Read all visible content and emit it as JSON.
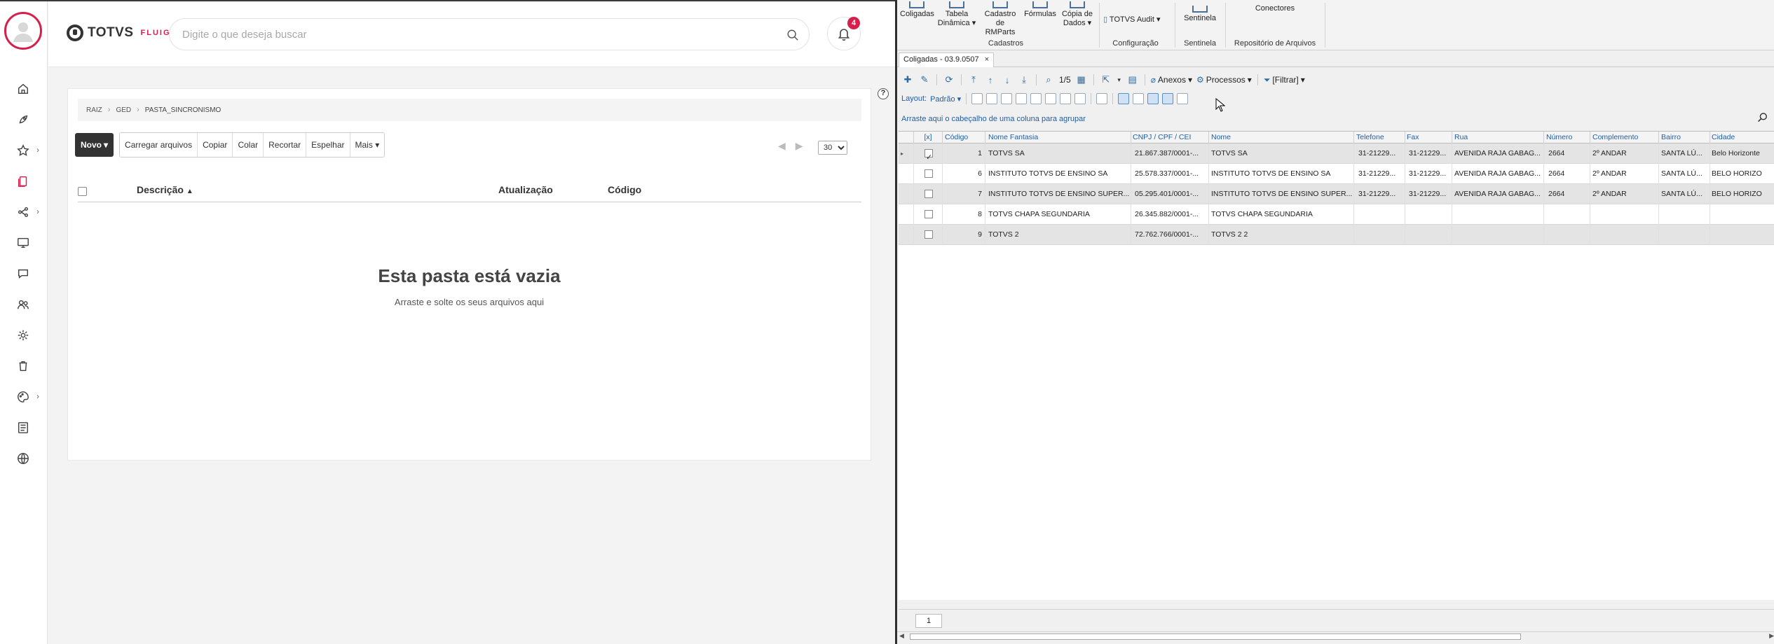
{
  "fluig": {
    "logo": {
      "word": "TOTVS",
      "sub": "FLUIG"
    },
    "search_placeholder": "Digite o que deseja buscar",
    "notifications_count": "4",
    "help_label": "?",
    "breadcrumb": [
      "RAIZ",
      "GED",
      "PASTA_SINCRONISMO"
    ],
    "toolbar": {
      "new_label": "Novo",
      "actions": [
        "Carregar arquivos",
        "Copiar",
        "Colar",
        "Recortar",
        "Espelhar"
      ],
      "more_label": "Mais"
    },
    "per_page": "30",
    "columns": {
      "description": "Descrição",
      "updated": "Atualização",
      "code": "Código"
    },
    "empty_title": "Esta pasta está vazia",
    "empty_subtitle": "Arraste e solte os seus arquivos aqui",
    "nav_icons": [
      "home-icon",
      "rocket-icon",
      "star-icon",
      "documents-icon",
      "workflow-icon",
      "monitor-icon",
      "chat-icon",
      "people-icon",
      "gear-icon",
      "trash-icon",
      "palette-icon",
      "list-icon",
      "globe-icon"
    ],
    "accent": "#d5204c"
  },
  "rm": {
    "ribbon": {
      "buttons": [
        {
          "label": "Coligadas"
        },
        {
          "label": "Tabela Dinâmica"
        },
        {
          "label": "Cadastro de RMParts"
        },
        {
          "label": "Fórmulas"
        },
        {
          "label": "Cópia de Dados"
        },
        {
          "label": "TOTVS Audit"
        },
        {
          "label": "Sentinela"
        },
        {
          "label": "Conectores"
        }
      ],
      "groups": [
        "Cadastros",
        "Configuração",
        "Sentinela",
        "Repositório de Arquivos"
      ]
    },
    "doc_tab": "Coligadas - 03.9.0507",
    "nav_counter": "1/5",
    "menus": {
      "attachments": "Anexos",
      "processes": "Processos",
      "filter": "[Filtrar]"
    },
    "layout_label": "Layout:",
    "layout_value": "Padrão",
    "group_hint": "Arraste aqui o cabeçalho de uma coluna para agrupar",
    "grid_headers": [
      "[x]",
      "Código",
      "Nome Fantasia",
      "CNPJ / CPF / CEI",
      "Nome",
      "Telefone",
      "Fax",
      "Rua",
      "Número",
      "Complemento",
      "Bairro",
      "Cidade"
    ],
    "rows": [
      {
        "checked": true,
        "cells": [
          "1",
          "TOTVS SA",
          "21.867.387/0001-...",
          "TOTVS SA",
          "31-21229...",
          "31-21229...",
          "AVENIDA RAJA GABAG...",
          "2664",
          "2º ANDAR",
          "SANTA LÚ...",
          "Belo Horizonte"
        ]
      },
      {
        "checked": false,
        "cells": [
          "6",
          "INSTITUTO TOTVS DE ENSINO SA",
          "25.578.337/0001-...",
          "INSTITUTO TOTVS DE ENSINO SA",
          "31-21229...",
          "31-21229...",
          "AVENIDA RAJA GABAG...",
          "2664",
          "2º ANDAR",
          "SANTA LÚ...",
          "BELO HORIZO"
        ]
      },
      {
        "checked": false,
        "cells": [
          "7",
          "INSTITUTO TOTVS DE ENSINO SUPER...",
          "05.295.401/0001-...",
          "INSTITUTO TOTVS DE ENSINO SUPER...",
          "31-21229...",
          "31-21229...",
          "AVENIDA RAJA GABAG...",
          "2664",
          "2º ANDAR",
          "SANTA LÚ...",
          "BELO HORIZO"
        ]
      },
      {
        "checked": false,
        "cells": [
          "8",
          "TOTVS CHAPA SEGUNDARIA",
          "26.345.882/0001-...",
          "TOTVS CHAPA SEGUNDARIA",
          "",
          "",
          "",
          "",
          "",
          "",
          ""
        ]
      },
      {
        "checked": false,
        "cells": [
          "9",
          "TOTVS 2",
          "72.762.766/0001-...",
          "TOTVS 2 2",
          "",
          "",
          "",
          "",
          "",
          "",
          ""
        ]
      }
    ],
    "page_number": "1"
  }
}
